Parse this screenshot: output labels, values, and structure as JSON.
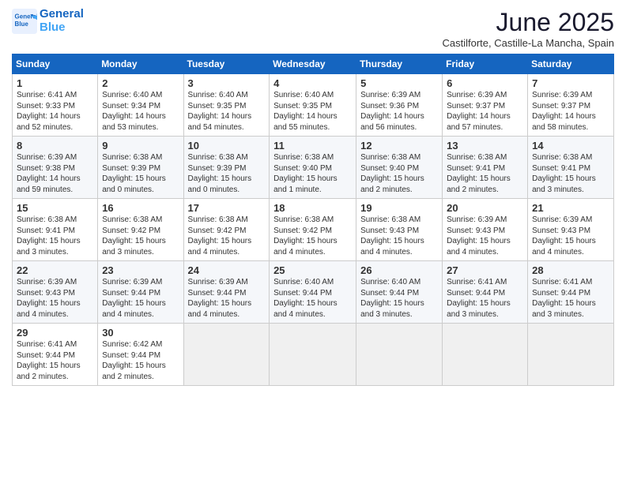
{
  "logo": {
    "line1": "General",
    "line2": "Blue"
  },
  "title": "June 2025",
  "subtitle": "Castilforte, Castille-La Mancha, Spain",
  "headers": [
    "Sunday",
    "Monday",
    "Tuesday",
    "Wednesday",
    "Thursday",
    "Friday",
    "Saturday"
  ],
  "weeks": [
    [
      {
        "day": "1",
        "lines": [
          "Sunrise: 6:41 AM",
          "Sunset: 9:33 PM",
          "Daylight: 14 hours",
          "and 52 minutes."
        ]
      },
      {
        "day": "2",
        "lines": [
          "Sunrise: 6:40 AM",
          "Sunset: 9:34 PM",
          "Daylight: 14 hours",
          "and 53 minutes."
        ]
      },
      {
        "day": "3",
        "lines": [
          "Sunrise: 6:40 AM",
          "Sunset: 9:35 PM",
          "Daylight: 14 hours",
          "and 54 minutes."
        ]
      },
      {
        "day": "4",
        "lines": [
          "Sunrise: 6:40 AM",
          "Sunset: 9:35 PM",
          "Daylight: 14 hours",
          "and 55 minutes."
        ]
      },
      {
        "day": "5",
        "lines": [
          "Sunrise: 6:39 AM",
          "Sunset: 9:36 PM",
          "Daylight: 14 hours",
          "and 56 minutes."
        ]
      },
      {
        "day": "6",
        "lines": [
          "Sunrise: 6:39 AM",
          "Sunset: 9:37 PM",
          "Daylight: 14 hours",
          "and 57 minutes."
        ]
      },
      {
        "day": "7",
        "lines": [
          "Sunrise: 6:39 AM",
          "Sunset: 9:37 PM",
          "Daylight: 14 hours",
          "and 58 minutes."
        ]
      }
    ],
    [
      {
        "day": "8",
        "lines": [
          "Sunrise: 6:39 AM",
          "Sunset: 9:38 PM",
          "Daylight: 14 hours",
          "and 59 minutes."
        ]
      },
      {
        "day": "9",
        "lines": [
          "Sunrise: 6:38 AM",
          "Sunset: 9:39 PM",
          "Daylight: 15 hours",
          "and 0 minutes."
        ]
      },
      {
        "day": "10",
        "lines": [
          "Sunrise: 6:38 AM",
          "Sunset: 9:39 PM",
          "Daylight: 15 hours",
          "and 0 minutes."
        ]
      },
      {
        "day": "11",
        "lines": [
          "Sunrise: 6:38 AM",
          "Sunset: 9:40 PM",
          "Daylight: 15 hours",
          "and 1 minute."
        ]
      },
      {
        "day": "12",
        "lines": [
          "Sunrise: 6:38 AM",
          "Sunset: 9:40 PM",
          "Daylight: 15 hours",
          "and 2 minutes."
        ]
      },
      {
        "day": "13",
        "lines": [
          "Sunrise: 6:38 AM",
          "Sunset: 9:41 PM",
          "Daylight: 15 hours",
          "and 2 minutes."
        ]
      },
      {
        "day": "14",
        "lines": [
          "Sunrise: 6:38 AM",
          "Sunset: 9:41 PM",
          "Daylight: 15 hours",
          "and 3 minutes."
        ]
      }
    ],
    [
      {
        "day": "15",
        "lines": [
          "Sunrise: 6:38 AM",
          "Sunset: 9:41 PM",
          "Daylight: 15 hours",
          "and 3 minutes."
        ]
      },
      {
        "day": "16",
        "lines": [
          "Sunrise: 6:38 AM",
          "Sunset: 9:42 PM",
          "Daylight: 15 hours",
          "and 3 minutes."
        ]
      },
      {
        "day": "17",
        "lines": [
          "Sunrise: 6:38 AM",
          "Sunset: 9:42 PM",
          "Daylight: 15 hours",
          "and 4 minutes."
        ]
      },
      {
        "day": "18",
        "lines": [
          "Sunrise: 6:38 AM",
          "Sunset: 9:42 PM",
          "Daylight: 15 hours",
          "and 4 minutes."
        ]
      },
      {
        "day": "19",
        "lines": [
          "Sunrise: 6:38 AM",
          "Sunset: 9:43 PM",
          "Daylight: 15 hours",
          "and 4 minutes."
        ]
      },
      {
        "day": "20",
        "lines": [
          "Sunrise: 6:39 AM",
          "Sunset: 9:43 PM",
          "Daylight: 15 hours",
          "and 4 minutes."
        ]
      },
      {
        "day": "21",
        "lines": [
          "Sunrise: 6:39 AM",
          "Sunset: 9:43 PM",
          "Daylight: 15 hours",
          "and 4 minutes."
        ]
      }
    ],
    [
      {
        "day": "22",
        "lines": [
          "Sunrise: 6:39 AM",
          "Sunset: 9:43 PM",
          "Daylight: 15 hours",
          "and 4 minutes."
        ]
      },
      {
        "day": "23",
        "lines": [
          "Sunrise: 6:39 AM",
          "Sunset: 9:44 PM",
          "Daylight: 15 hours",
          "and 4 minutes."
        ]
      },
      {
        "day": "24",
        "lines": [
          "Sunrise: 6:39 AM",
          "Sunset: 9:44 PM",
          "Daylight: 15 hours",
          "and 4 minutes."
        ]
      },
      {
        "day": "25",
        "lines": [
          "Sunrise: 6:40 AM",
          "Sunset: 9:44 PM",
          "Daylight: 15 hours",
          "and 4 minutes."
        ]
      },
      {
        "day": "26",
        "lines": [
          "Sunrise: 6:40 AM",
          "Sunset: 9:44 PM",
          "Daylight: 15 hours",
          "and 3 minutes."
        ]
      },
      {
        "day": "27",
        "lines": [
          "Sunrise: 6:41 AM",
          "Sunset: 9:44 PM",
          "Daylight: 15 hours",
          "and 3 minutes."
        ]
      },
      {
        "day": "28",
        "lines": [
          "Sunrise: 6:41 AM",
          "Sunset: 9:44 PM",
          "Daylight: 15 hours",
          "and 3 minutes."
        ]
      }
    ],
    [
      {
        "day": "29",
        "lines": [
          "Sunrise: 6:41 AM",
          "Sunset: 9:44 PM",
          "Daylight: 15 hours",
          "and 2 minutes."
        ]
      },
      {
        "day": "30",
        "lines": [
          "Sunrise: 6:42 AM",
          "Sunset: 9:44 PM",
          "Daylight: 15 hours",
          "and 2 minutes."
        ]
      },
      {
        "day": "",
        "lines": []
      },
      {
        "day": "",
        "lines": []
      },
      {
        "day": "",
        "lines": []
      },
      {
        "day": "",
        "lines": []
      },
      {
        "day": "",
        "lines": []
      }
    ]
  ]
}
